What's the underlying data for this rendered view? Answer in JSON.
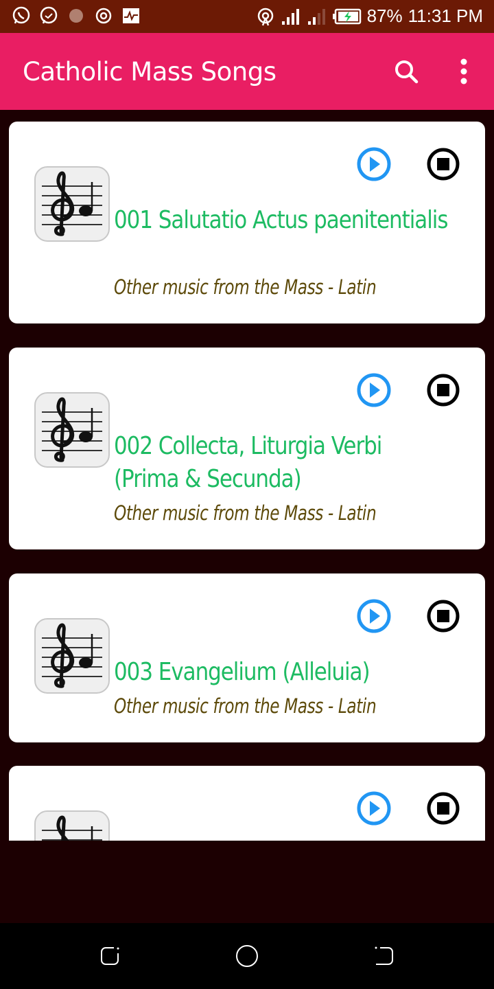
{
  "status_bar": {
    "notification_icons": [
      "whatsapp-icon",
      "messenger-icon",
      "app-icon",
      "record-icon",
      "activity-icon"
    ],
    "system_icons": [
      "hotspot-icon",
      "signal-icon",
      "signal-2-icon",
      "battery-charging-icon"
    ],
    "battery": "87%",
    "time": "11:31 PM"
  },
  "app_bar": {
    "title": "Catholic Mass Songs",
    "actions": [
      "search-icon",
      "more-vert-icon"
    ]
  },
  "songs": [
    {
      "title": "001 Salutatio Actus paenitentialis",
      "subtitle": "Other music from the Mass - Latin"
    },
    {
      "title": "002 Collecta, Liturgia Verbi (Prima & Secunda)",
      "subtitle": "Other music from the Mass - Latin"
    },
    {
      "title": "003 Evangelium (Alleluia)",
      "subtitle": "Other music from the Mass - Latin"
    },
    {
      "title": "",
      "subtitle": ""
    }
  ],
  "colors": {
    "status_bar": "#6c1a05",
    "app_bar": "#e91e63",
    "background": "#1c0002",
    "title_green": "#1dbb62",
    "subtitle_olive": "#5d4a0a",
    "play_blue": "#2196f3"
  },
  "nav_bar": {
    "buttons": [
      "recents-icon",
      "home-icon",
      "back-icon"
    ]
  }
}
